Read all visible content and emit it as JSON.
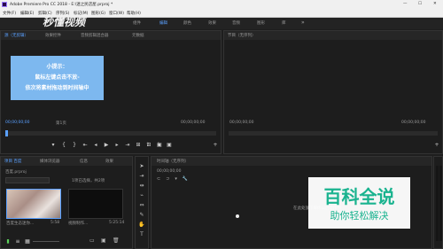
{
  "titlebar": {
    "title": "Adobe Premiere Pro CC 2018 - E:\\迷之民店屋.prproj *",
    "minimize": "—",
    "maximize": "☐",
    "close": "✕"
  },
  "menu": [
    "文件(F)",
    "编辑(E)",
    "剪辑(C)",
    "序列(S)",
    "标记(M)",
    "图形(G)",
    "窗口(W)",
    "帮助(H)"
  ],
  "watermark_top": "秒懂视频",
  "workspaces": [
    "组件",
    "编辑",
    "颜色",
    "效果",
    "音频",
    "图形",
    "库"
  ],
  "source_panel": {
    "tabs": [
      "源（无剪辑）",
      "效果控件",
      "音频剪辑混合器",
      "元数据"
    ],
    "tip_title": "小提示：",
    "tip_line1": "鼠标左键点击不放-",
    "tip_line2": "依次将素材拖动到时间轴中",
    "timecode_left": "00;00;00;00",
    "fit": "第1页",
    "timecode_right": "00;00;00;00"
  },
  "program_panel": {
    "title": "节目（无序列）",
    "timecode_left": "00;00;00;00",
    "timecode_right": "00;00;00;00"
  },
  "project_panel": {
    "tabs": [
      "项目 百度",
      "媒体浏览器",
      "信息",
      "效果"
    ],
    "name": "百度.prproj",
    "search_hint": "1项已选择，共2项",
    "clip1_name": "百度生态迷你...",
    "clip1_dur": "5:58",
    "clip2_name": "视频制作...",
    "clip2_dur": "5:25:14"
  },
  "timeline": {
    "tab": "时间轴（无序列）",
    "timecode": "00;00;00;00",
    "hint": "在此处放下媒体以创建序列"
  },
  "brand": {
    "title": "百科全说",
    "subtitle": "助你轻松解决"
  },
  "colors": {
    "accent": "#5aa0ff",
    "tip_bg": "#7db8ef",
    "brand": "#1ab38f"
  }
}
